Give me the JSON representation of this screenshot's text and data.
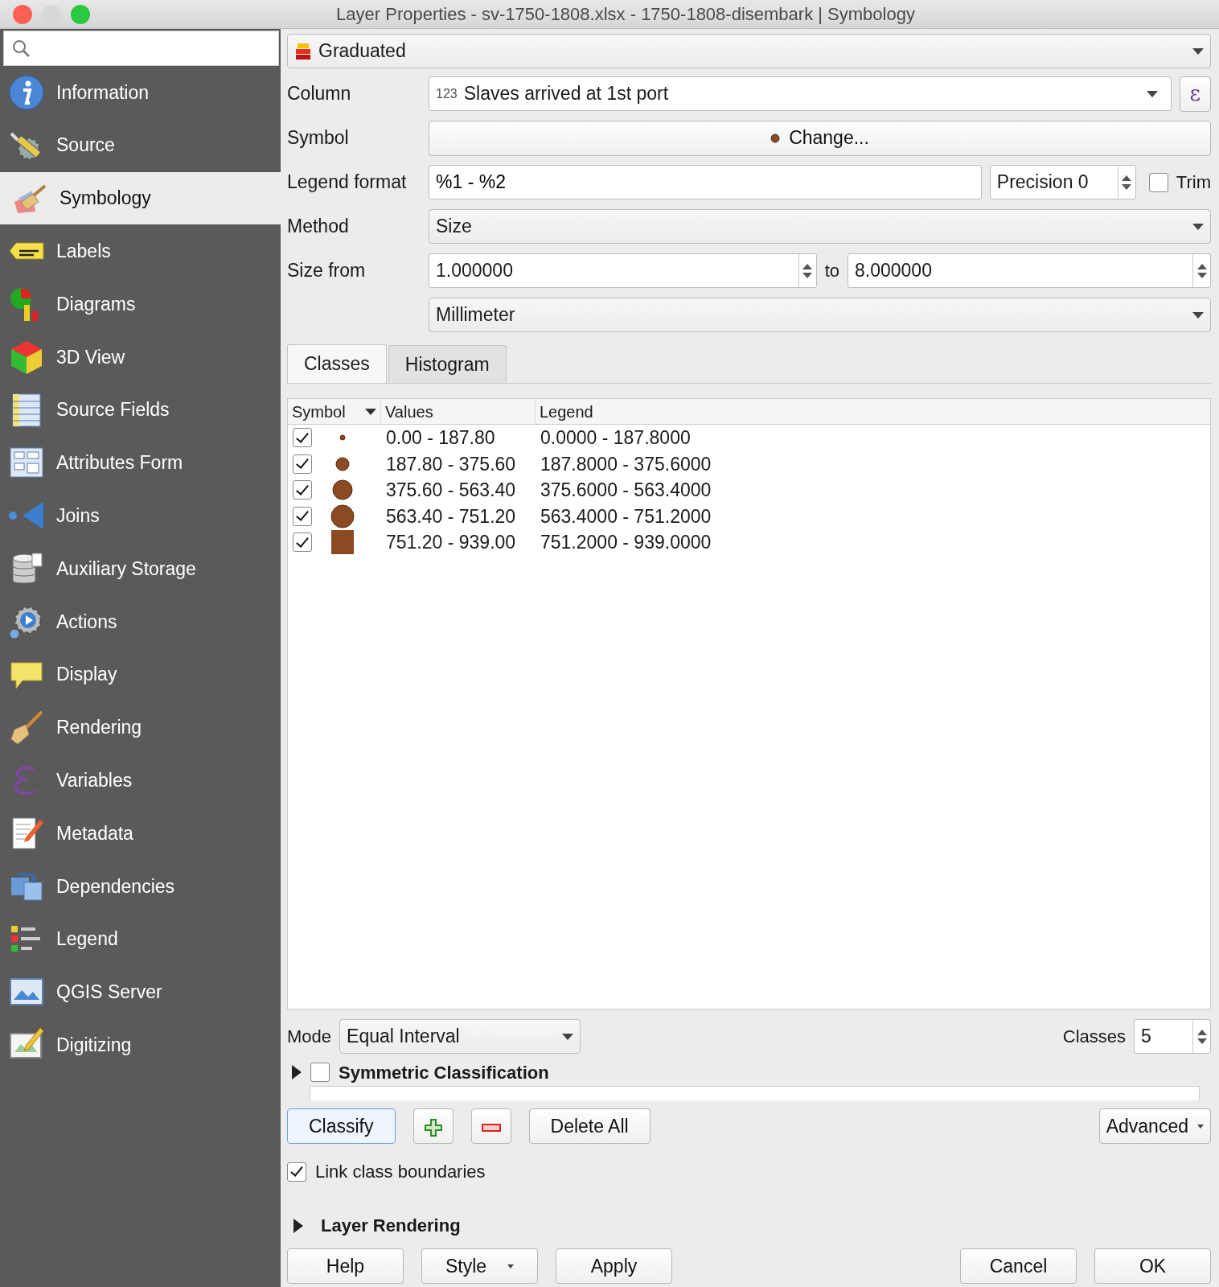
{
  "window": {
    "title": "Layer Properties - sv-1750-1808.xlsx - 1750-1808-disembark | Symbology"
  },
  "sidebar": {
    "items": [
      {
        "label": "Information",
        "selected": false
      },
      {
        "label": "Source",
        "selected": false
      },
      {
        "label": "Symbology",
        "selected": true
      },
      {
        "label": "Labels",
        "selected": false
      },
      {
        "label": "Diagrams",
        "selected": false
      },
      {
        "label": "3D View",
        "selected": false
      },
      {
        "label": "Source Fields",
        "selected": false
      },
      {
        "label": "Attributes Form",
        "selected": false
      },
      {
        "label": "Joins",
        "selected": false
      },
      {
        "label": "Auxiliary Storage",
        "selected": false
      },
      {
        "label": "Actions",
        "selected": false
      },
      {
        "label": "Display",
        "selected": false
      },
      {
        "label": "Rendering",
        "selected": false
      },
      {
        "label": "Variables",
        "selected": false
      },
      {
        "label": "Metadata",
        "selected": false
      },
      {
        "label": "Dependencies",
        "selected": false
      },
      {
        "label": "Legend",
        "selected": false
      },
      {
        "label": "QGIS Server",
        "selected": false
      },
      {
        "label": "Digitizing",
        "selected": false
      }
    ]
  },
  "renderer": "Graduated",
  "form": {
    "column_label": "Column",
    "column_type": "123",
    "column_value": "Slaves arrived at 1st port",
    "expression_button": "ε",
    "symbol_label": "Symbol",
    "symbol_button": "Change...",
    "legend_format_label": "Legend format",
    "legend_format_value": "%1 - %2",
    "precision": "Precision 0",
    "trim_label": "Trim",
    "trim_checked": false,
    "method_label": "Method",
    "method_value": "Size",
    "size_from_label": "Size from",
    "size_from_value": "1.000000",
    "to_label": "to",
    "size_to_value": "8.000000",
    "unit_value": "Millimeter"
  },
  "tabs": [
    {
      "label": "Classes",
      "selected": true
    },
    {
      "label": "Histogram",
      "selected": false
    }
  ],
  "table": {
    "columns": [
      "Symbol",
      "Values",
      "Legend"
    ],
    "rows": [
      {
        "checked": true,
        "values": "0.00 - 187.80",
        "legend": "0.0000 - 187.8000"
      },
      {
        "checked": true,
        "values": "187.80 - 375.60",
        "legend": "187.8000 - 375.6000"
      },
      {
        "checked": true,
        "values": "375.60 - 563.40",
        "legend": "375.6000 - 563.4000"
      },
      {
        "checked": true,
        "values": "563.40 - 751.20",
        "legend": "563.4000 - 751.2000"
      },
      {
        "checked": true,
        "values": "751.20 - 939.00",
        "legend": "751.2000 - 939.0000"
      }
    ]
  },
  "mode": {
    "label": "Mode",
    "value": "Equal Interval",
    "classes_label": "Classes",
    "classes_value": "5"
  },
  "symmetric": {
    "label": "Symmetric Classification",
    "checked": false
  },
  "actions": {
    "classify": "Classify",
    "delete_all": "Delete All",
    "advanced": "Advanced"
  },
  "link_boundaries": {
    "label": "Link class boundaries",
    "checked": true
  },
  "layer_rendering": "Layer Rendering",
  "footer": {
    "help": "Help",
    "style": "Style",
    "apply": "Apply",
    "cancel": "Cancel",
    "ok": "OK"
  }
}
